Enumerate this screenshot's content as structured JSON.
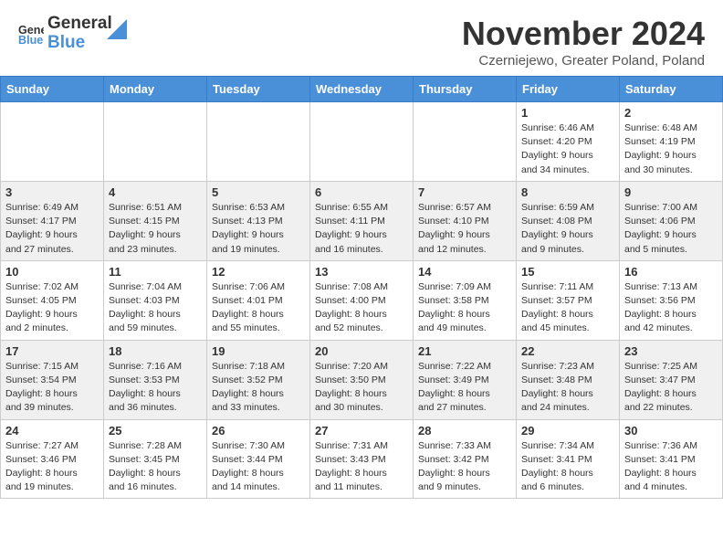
{
  "header": {
    "logo_general": "General",
    "logo_blue": "Blue",
    "month_title": "November 2024",
    "location": "Czerniejewo, Greater Poland, Poland"
  },
  "weekdays": [
    "Sunday",
    "Monday",
    "Tuesday",
    "Wednesday",
    "Thursday",
    "Friday",
    "Saturday"
  ],
  "weeks": [
    [
      {
        "day": "",
        "info": ""
      },
      {
        "day": "",
        "info": ""
      },
      {
        "day": "",
        "info": ""
      },
      {
        "day": "",
        "info": ""
      },
      {
        "day": "",
        "info": ""
      },
      {
        "day": "1",
        "info": "Sunrise: 6:46 AM\nSunset: 4:20 PM\nDaylight: 9 hours\nand 34 minutes."
      },
      {
        "day": "2",
        "info": "Sunrise: 6:48 AM\nSunset: 4:19 PM\nDaylight: 9 hours\nand 30 minutes."
      }
    ],
    [
      {
        "day": "3",
        "info": "Sunrise: 6:49 AM\nSunset: 4:17 PM\nDaylight: 9 hours\nand 27 minutes."
      },
      {
        "day": "4",
        "info": "Sunrise: 6:51 AM\nSunset: 4:15 PM\nDaylight: 9 hours\nand 23 minutes."
      },
      {
        "day": "5",
        "info": "Sunrise: 6:53 AM\nSunset: 4:13 PM\nDaylight: 9 hours\nand 19 minutes."
      },
      {
        "day": "6",
        "info": "Sunrise: 6:55 AM\nSunset: 4:11 PM\nDaylight: 9 hours\nand 16 minutes."
      },
      {
        "day": "7",
        "info": "Sunrise: 6:57 AM\nSunset: 4:10 PM\nDaylight: 9 hours\nand 12 minutes."
      },
      {
        "day": "8",
        "info": "Sunrise: 6:59 AM\nSunset: 4:08 PM\nDaylight: 9 hours\nand 9 minutes."
      },
      {
        "day": "9",
        "info": "Sunrise: 7:00 AM\nSunset: 4:06 PM\nDaylight: 9 hours\nand 5 minutes."
      }
    ],
    [
      {
        "day": "10",
        "info": "Sunrise: 7:02 AM\nSunset: 4:05 PM\nDaylight: 9 hours\nand 2 minutes."
      },
      {
        "day": "11",
        "info": "Sunrise: 7:04 AM\nSunset: 4:03 PM\nDaylight: 8 hours\nand 59 minutes."
      },
      {
        "day": "12",
        "info": "Sunrise: 7:06 AM\nSunset: 4:01 PM\nDaylight: 8 hours\nand 55 minutes."
      },
      {
        "day": "13",
        "info": "Sunrise: 7:08 AM\nSunset: 4:00 PM\nDaylight: 8 hours\nand 52 minutes."
      },
      {
        "day": "14",
        "info": "Sunrise: 7:09 AM\nSunset: 3:58 PM\nDaylight: 8 hours\nand 49 minutes."
      },
      {
        "day": "15",
        "info": "Sunrise: 7:11 AM\nSunset: 3:57 PM\nDaylight: 8 hours\nand 45 minutes."
      },
      {
        "day": "16",
        "info": "Sunrise: 7:13 AM\nSunset: 3:56 PM\nDaylight: 8 hours\nand 42 minutes."
      }
    ],
    [
      {
        "day": "17",
        "info": "Sunrise: 7:15 AM\nSunset: 3:54 PM\nDaylight: 8 hours\nand 39 minutes."
      },
      {
        "day": "18",
        "info": "Sunrise: 7:16 AM\nSunset: 3:53 PM\nDaylight: 8 hours\nand 36 minutes."
      },
      {
        "day": "19",
        "info": "Sunrise: 7:18 AM\nSunset: 3:52 PM\nDaylight: 8 hours\nand 33 minutes."
      },
      {
        "day": "20",
        "info": "Sunrise: 7:20 AM\nSunset: 3:50 PM\nDaylight: 8 hours\nand 30 minutes."
      },
      {
        "day": "21",
        "info": "Sunrise: 7:22 AM\nSunset: 3:49 PM\nDaylight: 8 hours\nand 27 minutes."
      },
      {
        "day": "22",
        "info": "Sunrise: 7:23 AM\nSunset: 3:48 PM\nDaylight: 8 hours\nand 24 minutes."
      },
      {
        "day": "23",
        "info": "Sunrise: 7:25 AM\nSunset: 3:47 PM\nDaylight: 8 hours\nand 22 minutes."
      }
    ],
    [
      {
        "day": "24",
        "info": "Sunrise: 7:27 AM\nSunset: 3:46 PM\nDaylight: 8 hours\nand 19 minutes."
      },
      {
        "day": "25",
        "info": "Sunrise: 7:28 AM\nSunset: 3:45 PM\nDaylight: 8 hours\nand 16 minutes."
      },
      {
        "day": "26",
        "info": "Sunrise: 7:30 AM\nSunset: 3:44 PM\nDaylight: 8 hours\nand 14 minutes."
      },
      {
        "day": "27",
        "info": "Sunrise: 7:31 AM\nSunset: 3:43 PM\nDaylight: 8 hours\nand 11 minutes."
      },
      {
        "day": "28",
        "info": "Sunrise: 7:33 AM\nSunset: 3:42 PM\nDaylight: 8 hours\nand 9 minutes."
      },
      {
        "day": "29",
        "info": "Sunrise: 7:34 AM\nSunset: 3:41 PM\nDaylight: 8 hours\nand 6 minutes."
      },
      {
        "day": "30",
        "info": "Sunrise: 7:36 AM\nSunset: 3:41 PM\nDaylight: 8 hours\nand 4 minutes."
      }
    ]
  ]
}
